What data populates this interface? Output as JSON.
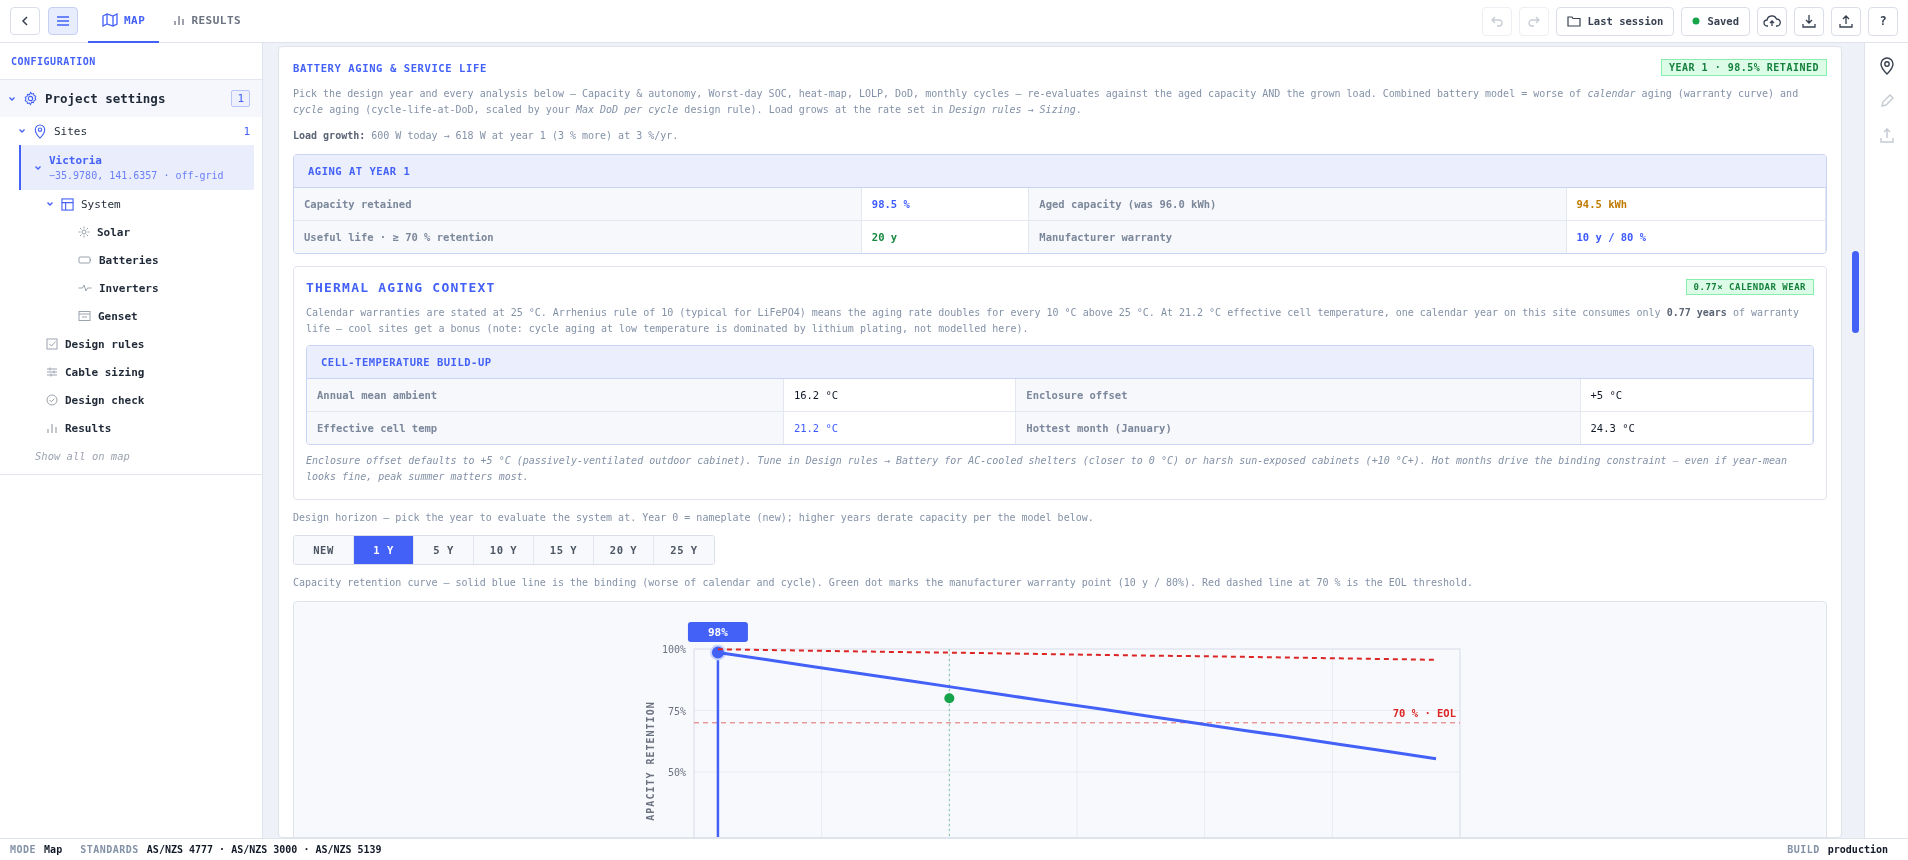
{
  "topbar": {
    "tabs": [
      {
        "label": "MAP",
        "kind": "map",
        "selected": true
      },
      {
        "label": "RESULTS",
        "kind": "results",
        "selected": false
      }
    ],
    "menu_open": true,
    "actions": [
      {
        "kind": "undo",
        "disabled": true
      },
      {
        "kind": "redo",
        "disabled": true
      },
      {
        "kind": "session",
        "label": "Last session",
        "disabled": false
      },
      {
        "kind": "status",
        "label": "Saved",
        "disabled": false
      },
      {
        "kind": "cloud",
        "disabled": false
      },
      {
        "kind": "download",
        "disabled": false
      },
      {
        "kind": "export",
        "disabled": false
      },
      {
        "kind": "help",
        "label": "?",
        "disabled": false
      }
    ]
  },
  "sidebar": {
    "title": "CONFIGURATION",
    "tree": [
      {
        "label": "Project settings",
        "kind": "project",
        "count": "1",
        "expanded": true,
        "selected": false,
        "children": [
          {
            "label": "Sites",
            "kind": "sites",
            "count": "1",
            "expanded": true,
            "selected": false,
            "children": [
              {
                "label": "Victoria",
                "subtitle": "−35.9780, 141.6357 · off-grid",
                "expanded": true,
                "selected": true,
                "children": [
                  {
                    "label": "System",
                    "kind": "system",
                    "expanded": true,
                    "selected": false,
                    "children": [
                      {
                        "label": "Solar",
                        "kind": "solar",
                        "selected": false
                      },
                      {
                        "label": "Batteries",
                        "kind": "batteries",
                        "selected": false
                      },
                      {
                        "label": "Inverters",
                        "kind": "inverters",
                        "selected": false
                      },
                      {
                        "label": "Genset",
                        "kind": "genset",
                        "selected": false
                      }
                    ]
                  },
                  {
                    "label": "Design rules",
                    "kind": "rules",
                    "selected": false
                  },
                  {
                    "label": "Cable sizing",
                    "kind": "cables",
                    "selected": false
                  },
                  {
                    "label": "Design check",
                    "kind": "check",
                    "selected": false
                  },
                  {
                    "label": "Results",
                    "kind": "results",
                    "selected": false
                  }
                ]
              }
            ]
          }
        ]
      }
    ],
    "link": "Show all on map"
  },
  "section": {
    "title": "BATTERY AGING & SERVICE LIFE",
    "badge": "YEAR 1 · 98.5% RETAINED",
    "intro": "Pick the design year and every analysis below — Capacity & autonomy, Worst-day SOC, heat-map, LOLP, DoD, monthly cycles — re-evaluates against the aged capacity AND the grown load. Combined battery model = worse of *calendar* aging (warranty curve) and *cycle* aging (cycle-life-at-DoD, scaled by your *Max DoD per cycle* design rule). Load grows at the rate set in *Design rules → Sizing*.",
    "load_growth": "**Load growth:** 600 W today → 618 W at year 1 (3 % more) at 3 %/yr.",
    "aging_table": {
      "title": "AGING AT YEAR 1",
      "rows": [
        [
          {
            "label": "Capacity retained",
            "value": "98.5 %",
            "color": "#3d5afe"
          },
          {
            "label": "Aged capacity (was 96.0 kWh)",
            "value": "94.5 kWh",
            "color": "#c07a00"
          }
        ],
        [
          {
            "label": "Useful life · ≥ 70 % retention",
            "value": "20 y",
            "color": "#16883e"
          },
          {
            "label": "Manufacturer warranty",
            "value": "10 y / 80 %",
            "color": "#3d5afe"
          }
        ]
      ]
    },
    "thermal": {
      "title": "THERMAL AGING CONTEXT",
      "badge": "0.77× CALENDAR WEAR",
      "text": "Calendar warranties are stated at 25 °C. Arrhenius rule of 10 (typical for LiFePO4) means the aging rate doubles for every 10 °C above 25 °C. At 21.2 °C effective cell temperature, one calendar year on this site consumes only **0.77 years** of warranty life — cool sites get a bonus (note: cycle aging at low temperature is dominated by lithium plating, not modelled here).",
      "table": {
        "title": "CELL-TEMPERATURE BUILD-UP",
        "rows": [
          [
            {
              "label": "Annual mean ambient",
              "value": "16.2 °C",
              "color": "#111827"
            },
            {
              "label": "Enclosure offset",
              "value": "+5 °C",
              "color": "#111827"
            }
          ],
          [
            {
              "label": "Effective cell temp",
              "value": "21.2 °C",
              "color": "#3d5afe"
            },
            {
              "label": "Hottest month (January)",
              "value": "24.3 °C",
              "color": "#111827"
            }
          ]
        ]
      },
      "note": "Enclosure offset defaults to +5 °C (passively-ventilated outdoor cabinet). Tune in Design rules → Battery for AC-cooled shelters (closer to 0 °C) or harsh sun-exposed cabinets (+10 °C+). Hot months drive the binding constraint — even if year-mean looks fine, peak summer matters most."
    },
    "horizon_hint": "Design horizon — pick the year to evaluate the system at. Year 0 = nameplate (new); higher years derate capacity per the model below.",
    "horizon_options": [
      {
        "label": "NEW",
        "selected": false
      },
      {
        "label": "1 Y",
        "selected": true
      },
      {
        "label": "5 Y",
        "selected": false
      },
      {
        "label": "10 Y",
        "selected": false
      },
      {
        "label": "15 Y",
        "selected": false
      },
      {
        "label": "20 Y",
        "selected": false
      },
      {
        "label": "25 Y",
        "selected": false
      }
    ],
    "chart_caption": "Capacity retention curve — solid blue line is the binding (worse of calendar and cycle). Green dot marks the manufacturer warranty point (10 y / 80%). Red dashed line at 70 % is the EOL threshold.",
    "chart": {
      "chart_data": {
        "type": "line",
        "ylabel": "APACITY RETENTION",
        "categories": [
          null,
          null,
          null,
          null,
          null,
          null,
          null,
          null,
          null,
          null,
          null,
          null,
          null,
          null,
          null,
          null
        ],
        "ylim": [
          0,
          100
        ],
        "yticks": [
          {
            "value": 100,
            "label": "100%"
          },
          {
            "value": 75,
            "label": "75%"
          },
          {
            "value": 50,
            "label": "50%"
          }
        ],
        "series": [
          {
            "color": "#4361f7",
            "line_style": "solid",
            "values": [
              98.6,
              95.7,
              92.8,
              89.9,
              87.1,
              84.2,
              81.3,
              78.4,
              75.6,
              72.7,
              69.8,
              66.9,
              64.1,
              61.2,
              58.3,
              55.4
            ]
          },
          {
            "color": "#dc2626",
            "line_style": "dashed",
            "values": [
              99.9,
              99.6,
              99.3,
              99.0,
              98.7,
              98.5,
              98.2,
              97.9,
              97.6,
              97.3,
              97.1,
              96.8,
              96.5,
              96.2,
              95.9,
              95.6
            ]
          }
        ],
        "ref_lines": [
          {
            "axis": "y",
            "value": 70,
            "label": "70 % · EOL",
            "color": "#e36a6a"
          }
        ],
        "annotations": [
          {
            "text": "98%"
          }
        ]
      }
    }
  },
  "rail": [
    {
      "kind": "pin",
      "disabled": false
    },
    {
      "kind": "edit",
      "disabled": true
    },
    {
      "kind": "upload",
      "disabled": true
    }
  ],
  "status_bar": {
    "items": [
      {
        "key": "MODE",
        "value": "Map"
      },
      {
        "key": "STANDARDS",
        "value": "AS/NZS 4777 · AS/NZS 3000 · AS/NZS 5139"
      }
    ],
    "build": {
      "key": "BUILD",
      "value": "production"
    }
  }
}
